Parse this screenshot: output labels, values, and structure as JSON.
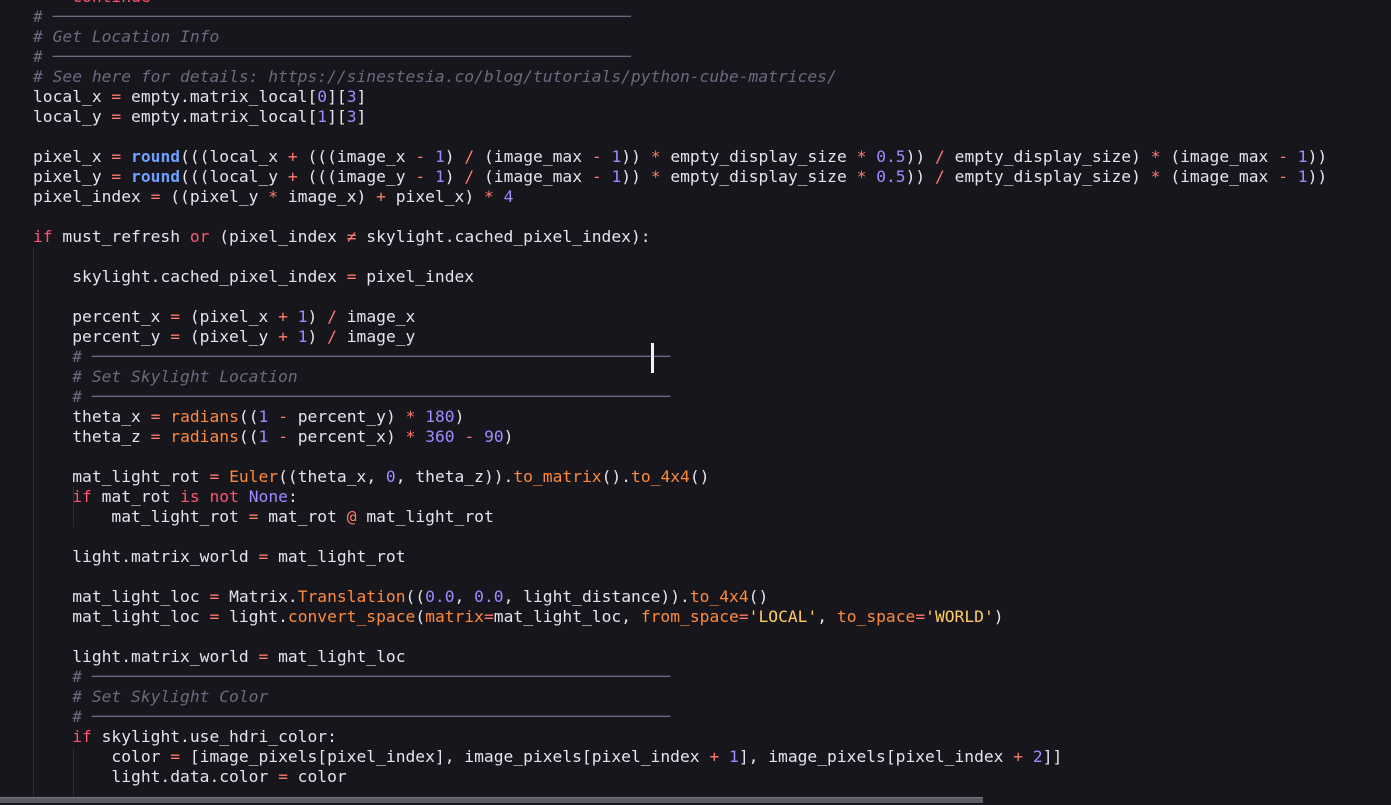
{
  "editor": {
    "lines": [
      [
        {
          "t": "    continue",
          "c": "keyword"
        }
      ],
      [
        {
          "t": "# ───────────────────────────────────────────────────────────",
          "c": "comment"
        }
      ],
      [
        {
          "t": "# Get Location Info",
          "c": "comment"
        }
      ],
      [
        {
          "t": "# ───────────────────────────────────────────────────────────",
          "c": "comment"
        }
      ],
      [
        {
          "t": "# See here for details: https://sinestesia.co/blog/tutorials/python-cube-matrices/",
          "c": "comment"
        }
      ],
      [
        {
          "t": "local_x ",
          "c": "text"
        },
        {
          "t": "=",
          "c": "op"
        },
        {
          "t": " empty.matrix_local[",
          "c": "text"
        },
        {
          "t": "0",
          "c": "number"
        },
        {
          "t": "][",
          "c": "text"
        },
        {
          "t": "3",
          "c": "number"
        },
        {
          "t": "]",
          "c": "text"
        }
      ],
      [
        {
          "t": "local_y ",
          "c": "text"
        },
        {
          "t": "=",
          "c": "op"
        },
        {
          "t": " empty.matrix_local[",
          "c": "text"
        },
        {
          "t": "1",
          "c": "number"
        },
        {
          "t": "][",
          "c": "text"
        },
        {
          "t": "3",
          "c": "number"
        },
        {
          "t": "]",
          "c": "text"
        }
      ],
      [],
      [
        {
          "t": "pixel_x ",
          "c": "text"
        },
        {
          "t": "=",
          "c": "op"
        },
        {
          "t": " ",
          "c": "text"
        },
        {
          "t": "round",
          "c": "bold"
        },
        {
          "t": "(((local_x ",
          "c": "text"
        },
        {
          "t": "+",
          "c": "op"
        },
        {
          "t": " (((image_x ",
          "c": "text"
        },
        {
          "t": "-",
          "c": "op"
        },
        {
          "t": " ",
          "c": "text"
        },
        {
          "t": "1",
          "c": "number"
        },
        {
          "t": ") ",
          "c": "text"
        },
        {
          "t": "/",
          "c": "op"
        },
        {
          "t": " (image_max ",
          "c": "text"
        },
        {
          "t": "-",
          "c": "op"
        },
        {
          "t": " ",
          "c": "text"
        },
        {
          "t": "1",
          "c": "number"
        },
        {
          "t": ")) ",
          "c": "text"
        },
        {
          "t": "*",
          "c": "op"
        },
        {
          "t": " empty_display_size ",
          "c": "text"
        },
        {
          "t": "*",
          "c": "op"
        },
        {
          "t": " ",
          "c": "text"
        },
        {
          "t": "0.5",
          "c": "number"
        },
        {
          "t": ")) ",
          "c": "text"
        },
        {
          "t": "/",
          "c": "op"
        },
        {
          "t": " empty_display_size) ",
          "c": "text"
        },
        {
          "t": "*",
          "c": "op"
        },
        {
          "t": " (image_max ",
          "c": "text"
        },
        {
          "t": "-",
          "c": "op"
        },
        {
          "t": " ",
          "c": "text"
        },
        {
          "t": "1",
          "c": "number"
        },
        {
          "t": "))",
          "c": "text"
        }
      ],
      [
        {
          "t": "pixel_y ",
          "c": "text"
        },
        {
          "t": "=",
          "c": "op"
        },
        {
          "t": " ",
          "c": "text"
        },
        {
          "t": "round",
          "c": "bold"
        },
        {
          "t": "(((local_y ",
          "c": "text"
        },
        {
          "t": "+",
          "c": "op"
        },
        {
          "t": " (((image_y ",
          "c": "text"
        },
        {
          "t": "-",
          "c": "op"
        },
        {
          "t": " ",
          "c": "text"
        },
        {
          "t": "1",
          "c": "number"
        },
        {
          "t": ") ",
          "c": "text"
        },
        {
          "t": "/",
          "c": "op"
        },
        {
          "t": " (image_max ",
          "c": "text"
        },
        {
          "t": "-",
          "c": "op"
        },
        {
          "t": " ",
          "c": "text"
        },
        {
          "t": "1",
          "c": "number"
        },
        {
          "t": ")) ",
          "c": "text"
        },
        {
          "t": "*",
          "c": "op"
        },
        {
          "t": " empty_display_size ",
          "c": "text"
        },
        {
          "t": "*",
          "c": "op"
        },
        {
          "t": " ",
          "c": "text"
        },
        {
          "t": "0.5",
          "c": "number"
        },
        {
          "t": ")) ",
          "c": "text"
        },
        {
          "t": "/",
          "c": "op"
        },
        {
          "t": " empty_display_size) ",
          "c": "text"
        },
        {
          "t": "*",
          "c": "op"
        },
        {
          "t": " (image_max ",
          "c": "text"
        },
        {
          "t": "-",
          "c": "op"
        },
        {
          "t": " ",
          "c": "text"
        },
        {
          "t": "1",
          "c": "number"
        },
        {
          "t": "))",
          "c": "text"
        }
      ],
      [
        {
          "t": "pixel_index ",
          "c": "text"
        },
        {
          "t": "=",
          "c": "op"
        },
        {
          "t": " ((pixel_y ",
          "c": "text"
        },
        {
          "t": "*",
          "c": "op"
        },
        {
          "t": " image_x) ",
          "c": "text"
        },
        {
          "t": "+",
          "c": "op"
        },
        {
          "t": " pixel_x) ",
          "c": "text"
        },
        {
          "t": "*",
          "c": "op"
        },
        {
          "t": " ",
          "c": "text"
        },
        {
          "t": "4",
          "c": "number"
        }
      ],
      [],
      [
        {
          "t": "if",
          "c": "keyword"
        },
        {
          "t": " must_refresh ",
          "c": "text"
        },
        {
          "t": "or",
          "c": "keyword"
        },
        {
          "t": " (pixel_index ",
          "c": "text"
        },
        {
          "t": "≠",
          "c": "op"
        },
        {
          "t": " skylight.cached_pixel_index):",
          "c": "text"
        }
      ],
      [],
      [
        {
          "t": "    skylight.cached_pixel_index ",
          "c": "text"
        },
        {
          "t": "=",
          "c": "op"
        },
        {
          "t": " pixel_index",
          "c": "text"
        }
      ],
      [],
      [
        {
          "t": "    percent_x ",
          "c": "text"
        },
        {
          "t": "=",
          "c": "op"
        },
        {
          "t": " (pixel_x ",
          "c": "text"
        },
        {
          "t": "+",
          "c": "op"
        },
        {
          "t": " ",
          "c": "text"
        },
        {
          "t": "1",
          "c": "number"
        },
        {
          "t": ") ",
          "c": "text"
        },
        {
          "t": "/",
          "c": "op"
        },
        {
          "t": " image_x",
          "c": "text"
        }
      ],
      [
        {
          "t": "    percent_y ",
          "c": "text"
        },
        {
          "t": "=",
          "c": "op"
        },
        {
          "t": " (pixel_y ",
          "c": "text"
        },
        {
          "t": "+",
          "c": "op"
        },
        {
          "t": " ",
          "c": "text"
        },
        {
          "t": "1",
          "c": "number"
        },
        {
          "t": ") ",
          "c": "text"
        },
        {
          "t": "/",
          "c": "op"
        },
        {
          "t": " image_y",
          "c": "text"
        }
      ],
      [
        {
          "t": "    # ───────────────────────────────────────────────────────────",
          "c": "comment"
        }
      ],
      [
        {
          "t": "    # Set Skylight Location",
          "c": "comment"
        }
      ],
      [
        {
          "t": "    # ───────────────────────────────────────────────────────────",
          "c": "comment"
        }
      ],
      [
        {
          "t": "    theta_x ",
          "c": "text"
        },
        {
          "t": "=",
          "c": "op"
        },
        {
          "t": " ",
          "c": "text"
        },
        {
          "t": "radians",
          "c": "func"
        },
        {
          "t": "((",
          "c": "text"
        },
        {
          "t": "1",
          "c": "number"
        },
        {
          "t": " ",
          "c": "text"
        },
        {
          "t": "-",
          "c": "op"
        },
        {
          "t": " percent_y) ",
          "c": "text"
        },
        {
          "t": "*",
          "c": "op"
        },
        {
          "t": " ",
          "c": "text"
        },
        {
          "t": "180",
          "c": "number"
        },
        {
          "t": ")",
          "c": "text"
        }
      ],
      [
        {
          "t": "    theta_z ",
          "c": "text"
        },
        {
          "t": "=",
          "c": "op"
        },
        {
          "t": " ",
          "c": "text"
        },
        {
          "t": "radians",
          "c": "func"
        },
        {
          "t": "((",
          "c": "text"
        },
        {
          "t": "1",
          "c": "number"
        },
        {
          "t": " ",
          "c": "text"
        },
        {
          "t": "-",
          "c": "op"
        },
        {
          "t": " percent_x) ",
          "c": "text"
        },
        {
          "t": "*",
          "c": "op"
        },
        {
          "t": " ",
          "c": "text"
        },
        {
          "t": "360",
          "c": "number"
        },
        {
          "t": " ",
          "c": "text"
        },
        {
          "t": "-",
          "c": "op"
        },
        {
          "t": " ",
          "c": "text"
        },
        {
          "t": "90",
          "c": "number"
        },
        {
          "t": ")",
          "c": "text"
        }
      ],
      [],
      [
        {
          "t": "    mat_light_rot ",
          "c": "text"
        },
        {
          "t": "=",
          "c": "op"
        },
        {
          "t": " ",
          "c": "text"
        },
        {
          "t": "Euler",
          "c": "func"
        },
        {
          "t": "((theta_x, ",
          "c": "text"
        },
        {
          "t": "0",
          "c": "number"
        },
        {
          "t": ", theta_z)).",
          "c": "text"
        },
        {
          "t": "to_matrix",
          "c": "func"
        },
        {
          "t": "().",
          "c": "text"
        },
        {
          "t": "to_4x4",
          "c": "func"
        },
        {
          "t": "()",
          "c": "text"
        }
      ],
      [
        {
          "t": "    ",
          "c": "text"
        },
        {
          "t": "if",
          "c": "keyword"
        },
        {
          "t": " mat_rot ",
          "c": "text"
        },
        {
          "t": "is",
          "c": "keyword"
        },
        {
          "t": " ",
          "c": "text"
        },
        {
          "t": "not",
          "c": "keyword"
        },
        {
          "t": " ",
          "c": "text"
        },
        {
          "t": "None",
          "c": "const"
        },
        {
          "t": ":",
          "c": "text"
        }
      ],
      [
        {
          "t": "        mat_light_rot ",
          "c": "text"
        },
        {
          "t": "=",
          "c": "op"
        },
        {
          "t": " mat_rot ",
          "c": "text"
        },
        {
          "t": "@",
          "c": "op"
        },
        {
          "t": " mat_light_rot",
          "c": "text"
        }
      ],
      [],
      [
        {
          "t": "    light.matrix_world ",
          "c": "text"
        },
        {
          "t": "=",
          "c": "op"
        },
        {
          "t": " mat_light_rot",
          "c": "text"
        }
      ],
      [],
      [
        {
          "t": "    mat_light_loc ",
          "c": "text"
        },
        {
          "t": "=",
          "c": "op"
        },
        {
          "t": " Matrix.",
          "c": "text"
        },
        {
          "t": "Translation",
          "c": "func"
        },
        {
          "t": "((",
          "c": "text"
        },
        {
          "t": "0.0",
          "c": "number"
        },
        {
          "t": ", ",
          "c": "text"
        },
        {
          "t": "0.0",
          "c": "number"
        },
        {
          "t": ", light_distance)).",
          "c": "text"
        },
        {
          "t": "to_4x4",
          "c": "func"
        },
        {
          "t": "()",
          "c": "text"
        }
      ],
      [
        {
          "t": "    mat_light_loc ",
          "c": "text"
        },
        {
          "t": "=",
          "c": "op"
        },
        {
          "t": " light.",
          "c": "text"
        },
        {
          "t": "convert_space",
          "c": "func"
        },
        {
          "t": "(",
          "c": "text"
        },
        {
          "t": "matrix",
          "c": "func"
        },
        {
          "t": "=",
          "c": "op"
        },
        {
          "t": "mat_light_loc, ",
          "c": "text"
        },
        {
          "t": "from_space",
          "c": "func"
        },
        {
          "t": "=",
          "c": "op"
        },
        {
          "t": "'LOCAL'",
          "c": "string"
        },
        {
          "t": ", ",
          "c": "text"
        },
        {
          "t": "to_space",
          "c": "func"
        },
        {
          "t": "=",
          "c": "op"
        },
        {
          "t": "'WORLD'",
          "c": "string"
        },
        {
          "t": ")",
          "c": "text"
        }
      ],
      [],
      [
        {
          "t": "    light.matrix_world ",
          "c": "text"
        },
        {
          "t": "=",
          "c": "op"
        },
        {
          "t": " mat_light_loc",
          "c": "text"
        }
      ],
      [
        {
          "t": "    # ───────────────────────────────────────────────────────────",
          "c": "comment"
        }
      ],
      [
        {
          "t": "    # Set Skylight Color",
          "c": "comment"
        }
      ],
      [
        {
          "t": "    # ───────────────────────────────────────────────────────────",
          "c": "comment"
        }
      ],
      [
        {
          "t": "    ",
          "c": "text"
        },
        {
          "t": "if",
          "c": "keyword"
        },
        {
          "t": " skylight.use_hdri_color:",
          "c": "text"
        }
      ],
      [
        {
          "t": "        color ",
          "c": "text"
        },
        {
          "t": "=",
          "c": "op"
        },
        {
          "t": " [image_pixels[pixel_index], image_pixels[pixel_index ",
          "c": "text"
        },
        {
          "t": "+",
          "c": "op"
        },
        {
          "t": " ",
          "c": "text"
        },
        {
          "t": "1",
          "c": "number"
        },
        {
          "t": "], image_pixels[pixel_index ",
          "c": "text"
        },
        {
          "t": "+",
          "c": "op"
        },
        {
          "t": " ",
          "c": "text"
        },
        {
          "t": "2",
          "c": "number"
        },
        {
          "t": "]]",
          "c": "text"
        }
      ],
      [
        {
          "t": "        light.data.color ",
          "c": "text"
        },
        {
          "t": "=",
          "c": "op"
        },
        {
          "t": " color",
          "c": "text"
        }
      ]
    ]
  }
}
